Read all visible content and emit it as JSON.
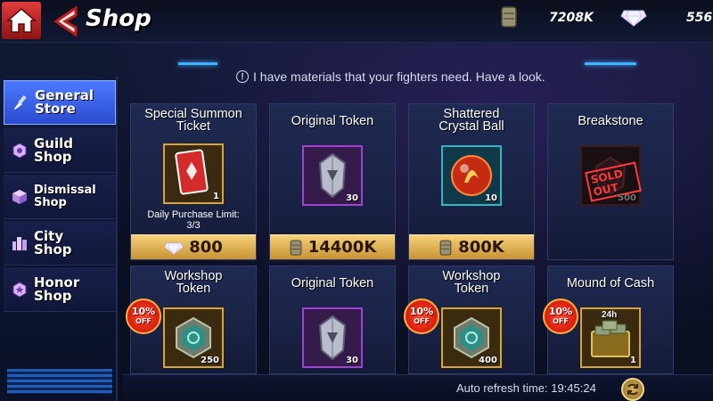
{
  "header": {
    "title": "Shop",
    "cash_value": "7208K",
    "gem_value": "556"
  },
  "message": "I have materials that your fighters need. Have a look.",
  "sidebar": {
    "items": [
      {
        "label": "General\nStore",
        "active": true
      },
      {
        "label": "Guild\nShop",
        "active": false
      },
      {
        "label": "Dismissal\nShop",
        "active": false
      },
      {
        "label": "City\nShop",
        "active": false
      },
      {
        "label": "Honor\nShop",
        "active": false
      }
    ]
  },
  "cards": [
    {
      "name": "Special Summon\nTicket",
      "qty": "1",
      "limit": "Daily Purchase Limit:\n3/3",
      "price": "800",
      "currency": "gem-icon"
    },
    {
      "name": "Original Token",
      "qty": "30",
      "price": "14400K",
      "currency": "cash-icon"
    },
    {
      "name": "Shattered\nCrystal Ball",
      "qty": "10",
      "price": "800K",
      "currency": "cash-icon"
    },
    {
      "name": "Breakstone",
      "qty": "500",
      "stamp": "SOLD OUT"
    },
    {
      "name": "Workshop\nToken",
      "qty": "250",
      "discount": "10%",
      "discount_suffix": "OFF"
    },
    {
      "name": "Original Token",
      "qty": "30"
    },
    {
      "name": "Workshop\nToken",
      "qty": "400",
      "discount": "10%",
      "discount_suffix": "OFF"
    },
    {
      "name": "Mound of Cash",
      "qty": "1",
      "discount": "10%",
      "discount_suffix": "OFF",
      "timer": "24h"
    }
  ],
  "footer": {
    "refresh_text": "Auto refresh time: 19:45:24"
  },
  "colors": {
    "active_tab": "#3f6bf0",
    "price_bar": "#e6b24a",
    "discount_badge": "#e0281a"
  }
}
